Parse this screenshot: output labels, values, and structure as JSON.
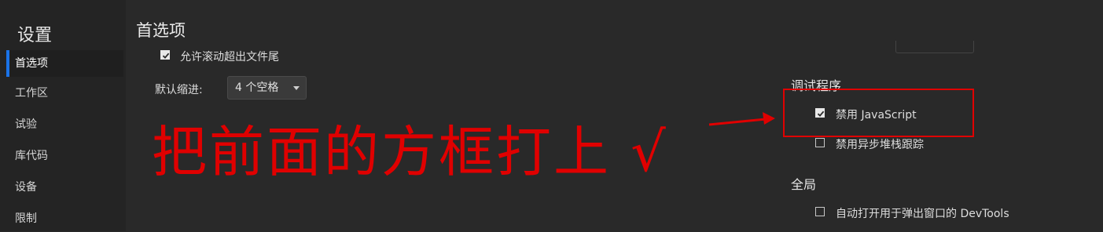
{
  "sidebar": {
    "title": "设置",
    "items": [
      {
        "label": "首选项",
        "active": true
      },
      {
        "label": "工作区"
      },
      {
        "label": "试验"
      },
      {
        "label": "库代码"
      },
      {
        "label": "设备"
      },
      {
        "label": "限制"
      }
    ]
  },
  "main": {
    "title": "首选项",
    "allow_scroll_label": "允许滚动超出文件尾",
    "allow_scroll_checked": true,
    "default_indent_label": "默认缩进:",
    "default_indent_value": "4 个空格"
  },
  "debugger": {
    "title": "调试程序",
    "disable_js_label": "禁用 JavaScript",
    "disable_js_checked": true,
    "disable_async_label": "禁用异步堆栈跟踪",
    "disable_async_checked": false
  },
  "global": {
    "title": "全局",
    "auto_open_label": "自动打开用于弹出窗口的 DevTools",
    "auto_open_checked": false
  },
  "annotation": {
    "text": "把前面的方框打上 √",
    "color": "#e00000"
  },
  "colors": {
    "accent": "#1a73e8",
    "background": "#292929",
    "sidebar": "#242424"
  }
}
